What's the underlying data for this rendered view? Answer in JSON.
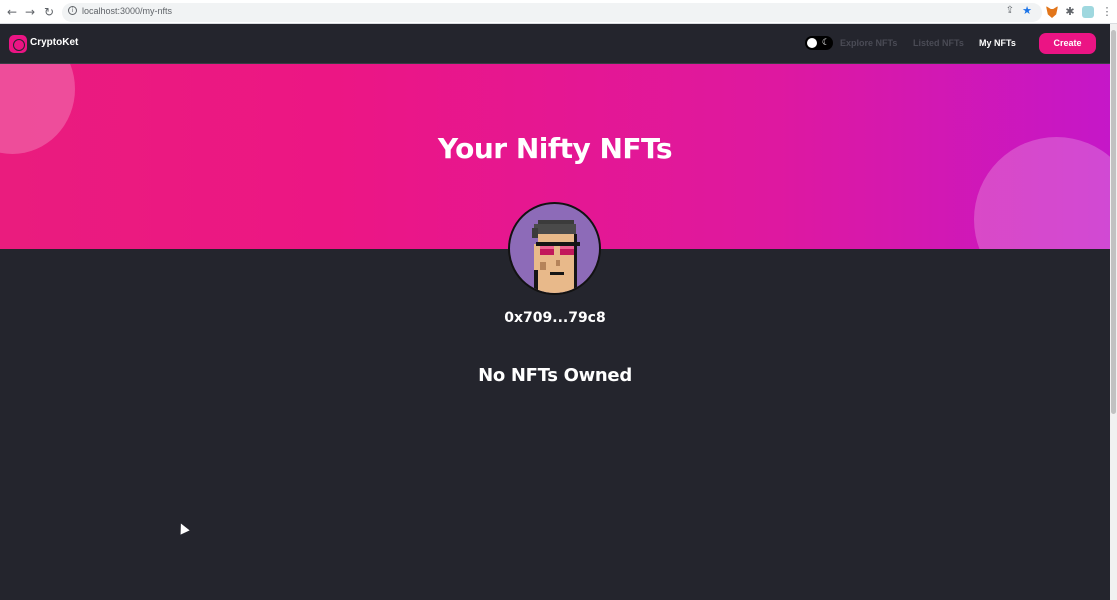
{
  "browser": {
    "url": "localhost:3000/my-nfts",
    "back_icon": "←",
    "forward_icon": "→",
    "reload_icon": "↻",
    "info_icon": "i",
    "share_icon": "⇪",
    "bookmark_icon": "★",
    "extensions_icon": "✱",
    "menu_icon": "⋮"
  },
  "navbar": {
    "brand": "CryptoKet",
    "theme_toggle_icon": "☾",
    "links": [
      "Explore NFTs",
      "Listed NFTs",
      "My NFTs"
    ],
    "active_link": "My NFTs",
    "create_label": "Create"
  },
  "banner": {
    "title": "Your Nifty NFTs"
  },
  "profile": {
    "address": "0x709...79c8"
  },
  "content": {
    "empty_message": "No NFTs Owned"
  },
  "colors": {
    "accent": "#eb1484",
    "background": "#24252d",
    "banner_start": "#ea1c7e",
    "banner_end": "#c517c8"
  }
}
